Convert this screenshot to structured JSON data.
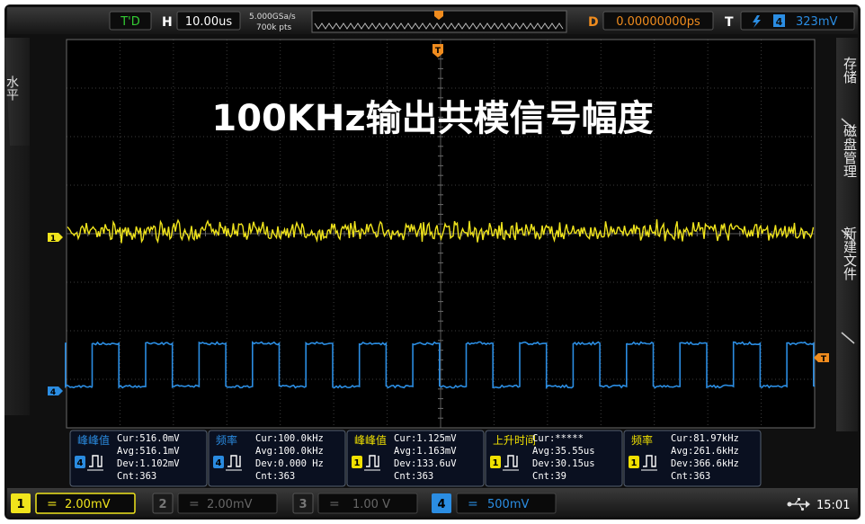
{
  "top_bar": {
    "run_status": "T'D",
    "horizontal_label": "H",
    "timebase": "10.00us",
    "sample_rate": "5.000GSa/s",
    "memory_depth": "700k pts",
    "delay_label": "D",
    "delay_value": "0.00000000ps",
    "trigger_label": "T",
    "trigger_source": "4",
    "trigger_level": "323mV"
  },
  "left_menu": {
    "label": "水平"
  },
  "right_menu": {
    "items": [
      {
        "label": "存储"
      },
      {
        "label": "磁盘管理"
      },
      {
        "label": "新建文件"
      }
    ]
  },
  "overlay": {
    "title": "100KHz输出共模信号幅度"
  },
  "markers": {
    "trigger_position": "T",
    "ch1": "1",
    "ch4": "4",
    "trigger_level": "T"
  },
  "measurements": [
    {
      "name": "峰峰值",
      "channel": "4",
      "color": "#2a8be0",
      "lines": [
        "Cur:516.0mV",
        "Avg:516.1mV",
        "Dev:1.102mV",
        "Cnt:363"
      ]
    },
    {
      "name": "频率",
      "channel": "4",
      "color": "#2a8be0",
      "lines": [
        "Cur:100.0kHz",
        "Avg:100.0kHz",
        "Dev:0.000 Hz",
        "Cnt:363"
      ]
    },
    {
      "name": "峰峰值",
      "channel": "1",
      "color": "#f0e000",
      "lines": [
        "Cur:1.125mV",
        "Avg:1.163mV",
        "Dev:133.6uV",
        "Cnt:363"
      ]
    },
    {
      "name": "上升时间",
      "channel": "1",
      "color": "#f0e000",
      "lines": [
        "Cur:*****",
        "Avg:35.55us",
        "Dev:30.15us",
        "Cnt:39"
      ]
    },
    {
      "name": "频率",
      "channel": "1",
      "color": "#f0e000",
      "lines": [
        "Cur:81.97kHz",
        "Avg:261.6kHz",
        "Dev:366.6kHz",
        "Cnt:363"
      ]
    }
  ],
  "channels": [
    {
      "number": "1",
      "scale": "2.00mV",
      "active": true
    },
    {
      "number": "2",
      "scale": "2.00mV",
      "active": false
    },
    {
      "number": "3",
      "scale": "1.00 V",
      "active": false
    },
    {
      "number": "4",
      "scale": "500mV",
      "active": true
    }
  ],
  "status": {
    "usb_icon": "usb-icon",
    "time": "15:01"
  },
  "colors": {
    "ch1": "#f0e41c",
    "ch4": "#2b8de2",
    "trigger": "#f08c1e",
    "grid": "#3c3c3c"
  },
  "waveform": {
    "square_period_us": 10,
    "screen_time_us": 140,
    "square_amplitude_mV": 516
  }
}
